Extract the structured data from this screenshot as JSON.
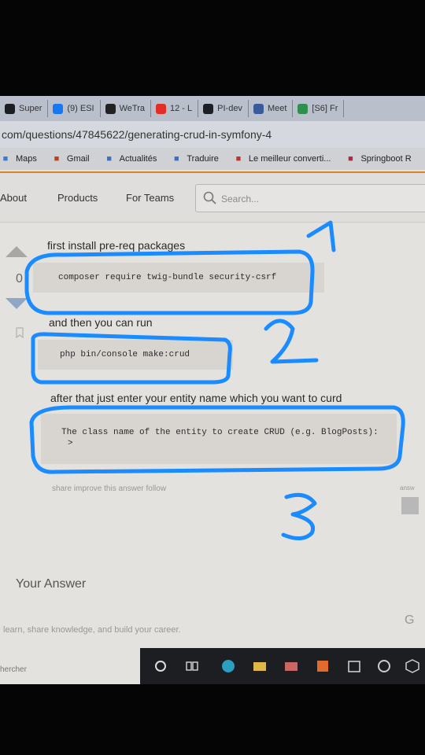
{
  "browser": {
    "tabs": [
      {
        "label": "Super",
        "icon": "github-icon",
        "color": "#1b1f24"
      },
      {
        "label": "(9) ESI",
        "icon": "facebook-icon",
        "color": "#1877f2"
      },
      {
        "label": "WeTra",
        "icon": "wetransfer-icon",
        "color": "#222222"
      },
      {
        "label": "12 - L",
        "icon": "youtube-icon",
        "color": "#e52d27"
      },
      {
        "label": "PI-dev",
        "icon": "github-icon",
        "color": "#1b1f24"
      },
      {
        "label": "Meet",
        "icon": "meet-icon",
        "color": "#3a5a9a"
      },
      {
        "label": "[S6] Fr",
        "icon": "drive-icon",
        "color": "#2f8f4e"
      }
    ],
    "url": "com/questions/47845622/generating-crud-in-symfony-4",
    "bookmarks": [
      {
        "label": "Maps",
        "icon": "maps-icon",
        "color": "#3b7bd6"
      },
      {
        "label": "Gmail",
        "icon": "gmail-icon",
        "color": "#c23b22"
      },
      {
        "label": "Actualités",
        "icon": "news-icon",
        "color": "#3e6fc0"
      },
      {
        "label": "Traduire",
        "icon": "translate-icon",
        "color": "#3e6fc0"
      },
      {
        "label": "Le meilleur converti...",
        "icon": "converter-icon",
        "color": "#c53030"
      },
      {
        "label": "Springboot R",
        "icon": "spring-icon",
        "color": "#b24"
      }
    ]
  },
  "header": {
    "nav": [
      "About",
      "Products",
      "For Teams"
    ],
    "search_placeholder": "Search..."
  },
  "answer": {
    "vote_count": "0",
    "line1": "first install pre-req packages",
    "code1": "composer require twig-bundle security-csrf",
    "line2": "and then you can run",
    "code2": "php bin/console make:crud",
    "line3": "after that just enter your entity name which you want to curd",
    "code3_line1": "The class name of the entity to create CRUD (e.g. BlogPosts):",
    "code3_line2": ">",
    "actions": "share  improve this answer  follow",
    "answered_label": "answ"
  },
  "your_answer": {
    "heading": "Your Answer",
    "footer": "learn, share knowledge, and build your career.",
    "side": "G"
  },
  "taskbar": {
    "search_text": "hercher"
  },
  "annotations": {
    "color": "#1a8cff",
    "numbers": [
      "1",
      "2",
      "3"
    ]
  }
}
